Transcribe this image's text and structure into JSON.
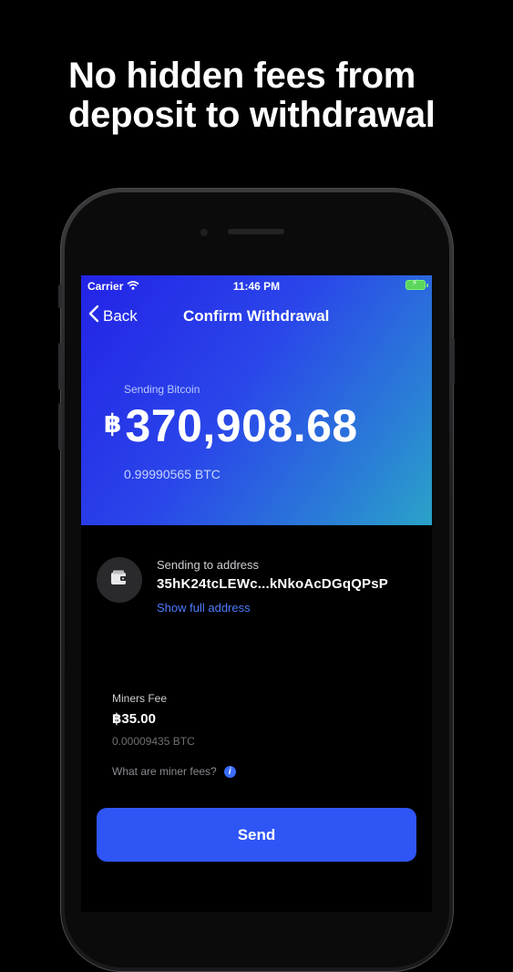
{
  "headline": {
    "line1": "No hidden fees from",
    "line2": "deposit to withdrawal"
  },
  "status_bar": {
    "carrier": "Carrier",
    "time": "11:46 PM",
    "icons": [
      "wifi-icon",
      "battery-charging-icon"
    ]
  },
  "nav": {
    "back_label": "Back",
    "title": "Confirm Withdrawal"
  },
  "hero": {
    "label": "Sending Bitcoin",
    "currency_symbol": "฿",
    "amount": "370,908.68",
    "btc_amount": "0.99990565 BTC"
  },
  "address": {
    "label": "Sending to address",
    "value": "35hK24tcLEWc...kNkoAcDGqQPsP",
    "show_full_label": "Show full address",
    "icon": "wallet-icon"
  },
  "fee": {
    "label": "Miners Fee",
    "amount": "฿35.00",
    "btc": "0.00009435 BTC",
    "help_text": "What are miner fees?",
    "help_icon": "info-icon"
  },
  "send_button": {
    "label": "Send"
  },
  "colors": {
    "accent": "#2f55f5",
    "link": "#4d7cff",
    "background": "#000000"
  }
}
